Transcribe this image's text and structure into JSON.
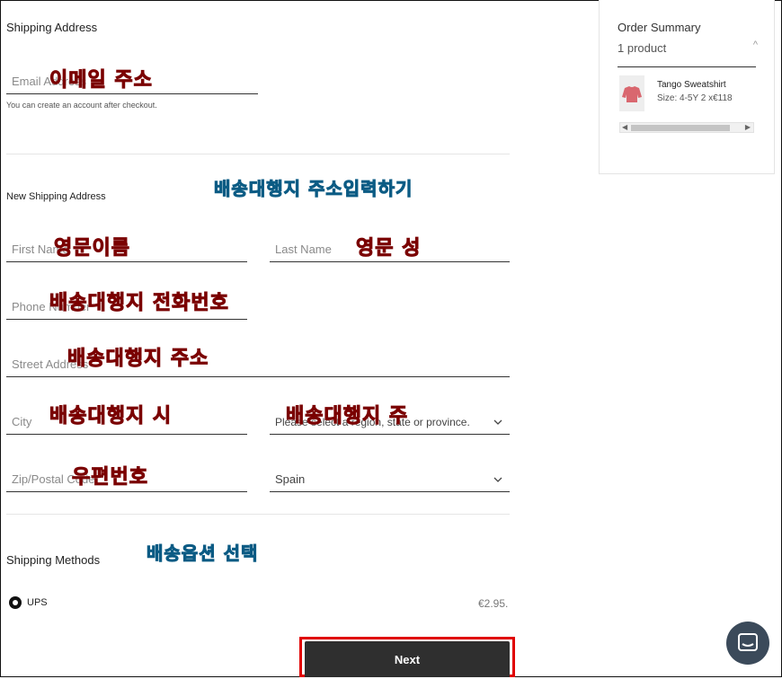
{
  "shipping_address": {
    "heading": "Shipping Address",
    "email_placeholder": "Email Address",
    "email_helper": "You can create an account after checkout."
  },
  "new_address": {
    "heading": "New Shipping Address",
    "first_name_placeholder": "First Name",
    "last_name_placeholder": "Last Name",
    "phone_placeholder": "Phone Number",
    "street_placeholder": "Street Address",
    "city_placeholder": "City",
    "state_placeholder": "Please select a region, state or province.",
    "zip_placeholder": "Zip/Postal Code",
    "country_value": "Spain"
  },
  "shipping_methods": {
    "heading": "Shipping Methods",
    "option_label": "UPS",
    "option_price": "€2.95."
  },
  "next_label": "Next",
  "order_summary": {
    "title": "Order Summary",
    "count": "1 product",
    "product_name": "Tango Sweatshirt",
    "product_meta": "Size:  4-5Y      2 x€118"
  },
  "annotations": {
    "email": "이메일 주소",
    "new_address": "배송대행지 주소입력하기",
    "first_name": "영문이름",
    "last_name": "영문 성",
    "phone": "배송대행지 전화번호",
    "street": "배송대행지 주소",
    "city": "배송대행지 시",
    "state": "배송대행지 주",
    "zip": "우편번호",
    "shipping_option": "배송옵션 선택"
  },
  "colors": {
    "annotation_red": "#e00000",
    "annotation_blue": "#35b7e9",
    "button_dark": "#2f2f2f",
    "highlight_border": "#e00000"
  },
  "icons": {
    "chevron": "chevron-down-icon",
    "chat": "chat-bubble-icon",
    "caret_up": "caret-up-icon"
  }
}
